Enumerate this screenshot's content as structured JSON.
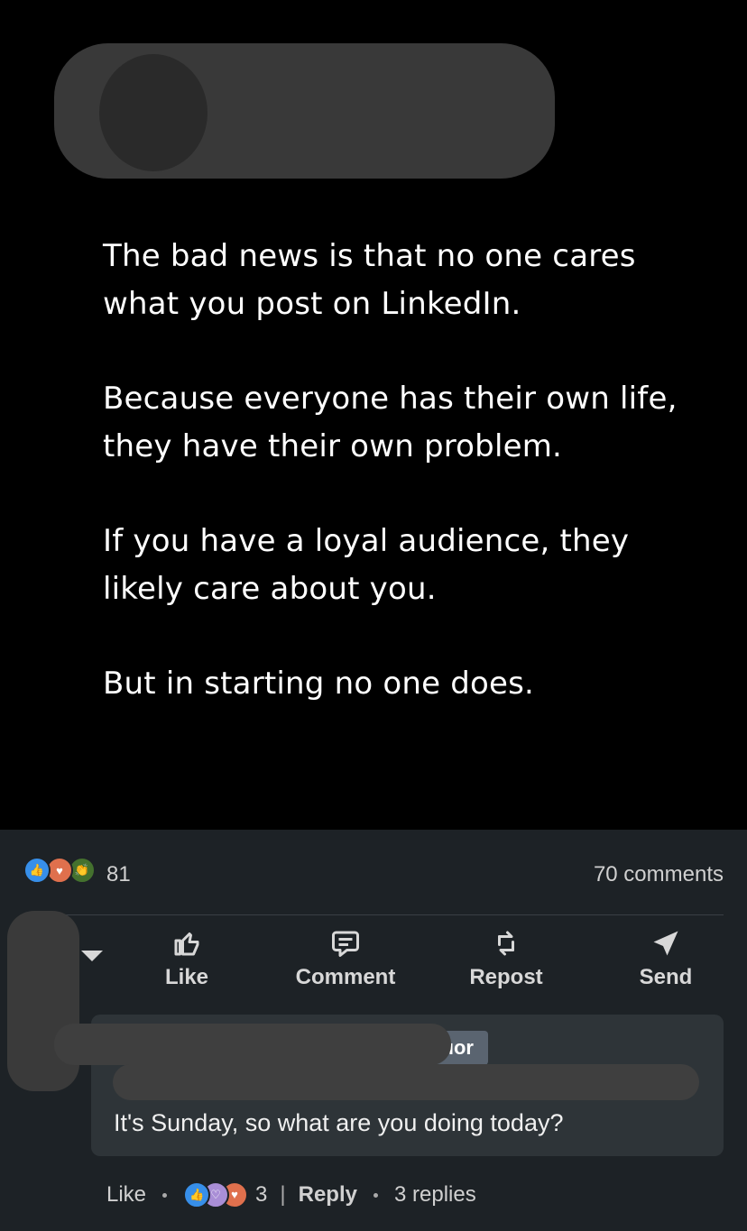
{
  "post": {
    "paragraphs": [
      "The bad news is that no one cares what you post on LinkedIn.",
      "Because everyone has their own life, they have their own problem.",
      "If you have a loyal audience, they likely care about you.",
      "But in starting no one does."
    ]
  },
  "social": {
    "reaction_icons": [
      "like-icon",
      "love-icon",
      "celebrate-icon"
    ],
    "reaction_count": "81",
    "comments_label": "70 comments"
  },
  "actions": [
    {
      "label": "Like",
      "icon": "thumbs-up-icon"
    },
    {
      "label": "Comment",
      "icon": "comment-icon"
    },
    {
      "label": "Repost",
      "icon": "repost-icon"
    },
    {
      "label": "Send",
      "icon": "send-icon"
    }
  ],
  "comment": {
    "badge_fragment": "ıor",
    "text": "It's Sunday, so what are you doing today?",
    "like_label": "Like",
    "reaction_icons": [
      "like-icon",
      "support-icon",
      "love-icon"
    ],
    "reaction_count": "3",
    "separator": "|",
    "reply_label": "Reply",
    "replies_label": "3 replies"
  },
  "colors": {
    "background": "#1d2226",
    "post_bg": "#000000",
    "comment_bg": "#2e3438",
    "like_blue": "#378fe9",
    "love_red": "#df704d",
    "celebrate_green": "#44712e"
  }
}
